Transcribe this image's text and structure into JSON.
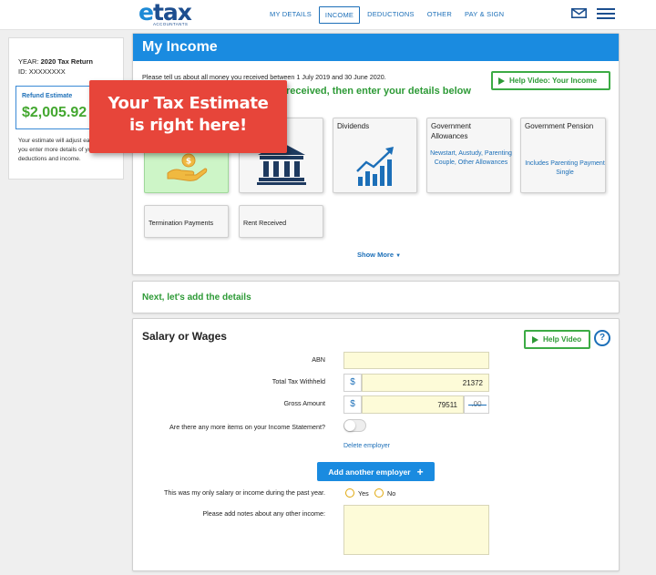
{
  "brand": {
    "logo_e": "e",
    "logo_rest": "tax",
    "logo_sub": "ACCOUNTANTS"
  },
  "nav": {
    "items": [
      {
        "label": "MY DETAILS",
        "active": false
      },
      {
        "label": "INCOME",
        "active": true
      },
      {
        "label": "DEDUCTIONS",
        "active": false
      },
      {
        "label": "OTHER",
        "active": false
      },
      {
        "label": "PAY & SIGN",
        "active": false
      }
    ]
  },
  "sidebar": {
    "year_prefix": "YEAR:",
    "year_value": "2020 Tax Return",
    "id_prefix": "ID:",
    "id_value": "XXXXXXXX",
    "refund_label": "Refund Estimate",
    "refund_amount": "$2,005.92",
    "note": "Your estimate will adjust each time you enter more details of your deductions and income."
  },
  "income": {
    "title": "My Income",
    "intro": "Please tell us about all money you received between 1 July 2019 and 30 June 2020.",
    "help_video": "Help Video: Your Income",
    "headline": "received, then enter your details below",
    "tiles": [
      {
        "title": "Dividends",
        "sub": ""
      },
      {
        "title": "Government\nAllowances",
        "sub": "Newstart, Austudy, Parenting Couple, Other Allowances"
      },
      {
        "title": "Government Pension",
        "sub": "Includes Parenting Payment Single"
      },
      {
        "title": "Termination Payments",
        "sub": ""
      },
      {
        "title": "Rent Received",
        "sub": ""
      }
    ],
    "show_more": "Show More"
  },
  "next": {
    "text": "Next, let's add the details"
  },
  "salary": {
    "title": "Salary or Wages",
    "help_video": "Help Video",
    "help_icon": "?",
    "abn_label": "ABN",
    "abn_value": "",
    "tax_label": "Total Tax Withheld",
    "tax_value": "21372",
    "gross_label": "Gross Amount",
    "gross_value": "79511",
    "gross_cents": ".00",
    "currency": "$",
    "more_items_label": "Are there any more items on your Income Statement?",
    "delete_employer": "Delete employer",
    "add_employer": "Add another employer",
    "only_income_label": "This was my only salary or income during the past year.",
    "yes": "Yes",
    "no": "No",
    "notes_label": "Please add notes about any other income:",
    "notes_value": ""
  },
  "callout": {
    "line1": "Your Tax Estimate",
    "line2": "is right here!"
  },
  "icons": [
    "mail-icon",
    "menu-icon",
    "money-hand-icon",
    "bank-icon",
    "chart-up-icon",
    "play-icon",
    "question-icon",
    "plus-icon",
    "caret-down-icon"
  ],
  "colors": {
    "primary": "#1a8be0",
    "green": "#2d9a36",
    "callout": "#e7453a",
    "refund": "#43a72f"
  }
}
